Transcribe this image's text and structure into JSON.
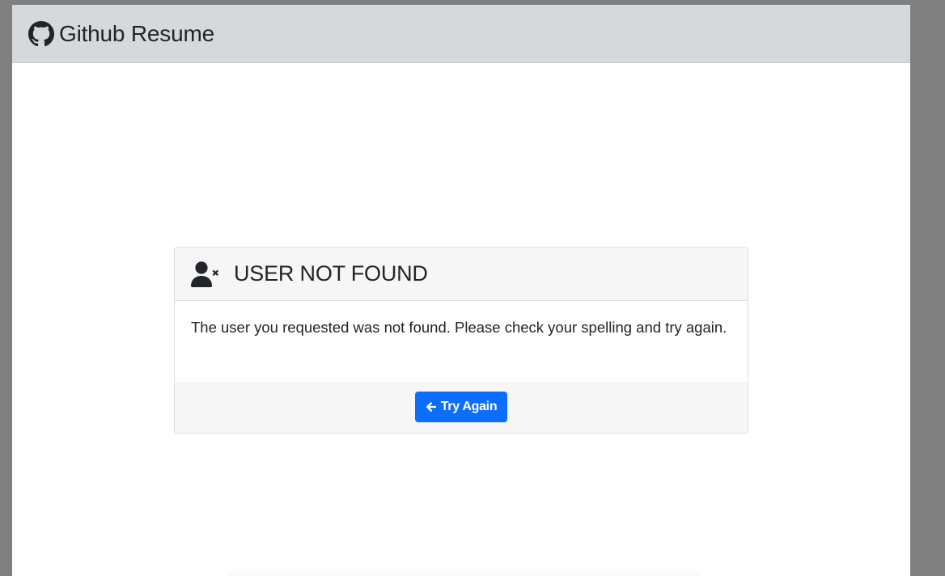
{
  "navbar": {
    "brand_icon": "github-icon",
    "brand_text": "Github Resume"
  },
  "error_card": {
    "icon": "user-x-icon",
    "title": "USER NOT FOUND",
    "message": "The user you requested was not found. Please check your spelling and try again.",
    "button": {
      "icon": "arrow-left-icon",
      "label": "Try Again"
    }
  },
  "colors": {
    "page_background": "#808080",
    "navbar_background": "#d5d9db",
    "card_header_background": "#f6f6f6",
    "primary_button": "#0d6efd",
    "text": "#212529"
  }
}
